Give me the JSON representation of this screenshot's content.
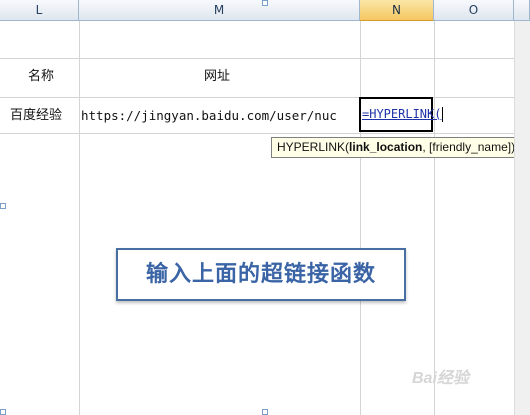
{
  "columns": [
    {
      "id": "L",
      "label": "L"
    },
    {
      "id": "M",
      "label": "M"
    },
    {
      "id": "N",
      "label": "N"
    },
    {
      "id": "O",
      "label": "O"
    }
  ],
  "cells": {
    "name_header": "名称",
    "url_header": "网址",
    "name_value": "百度经验",
    "url_value": "https://jingyan.baidu.com/user/nuc"
  },
  "active_cell": {
    "column": "N",
    "formula_text": "=HYPERLINK("
  },
  "tooltip": {
    "function": "HYPERLINK(",
    "arg_active": "link_location",
    "rest": ", [friendly_name])"
  },
  "annotation": "输入上面的超链接函数",
  "watermark": "Bai经验",
  "colors": {
    "header_bg": "#dfe6ef",
    "active_header": "#f5c762",
    "annotation_text": "#3a64a6",
    "formula_text": "#1f33a8"
  }
}
